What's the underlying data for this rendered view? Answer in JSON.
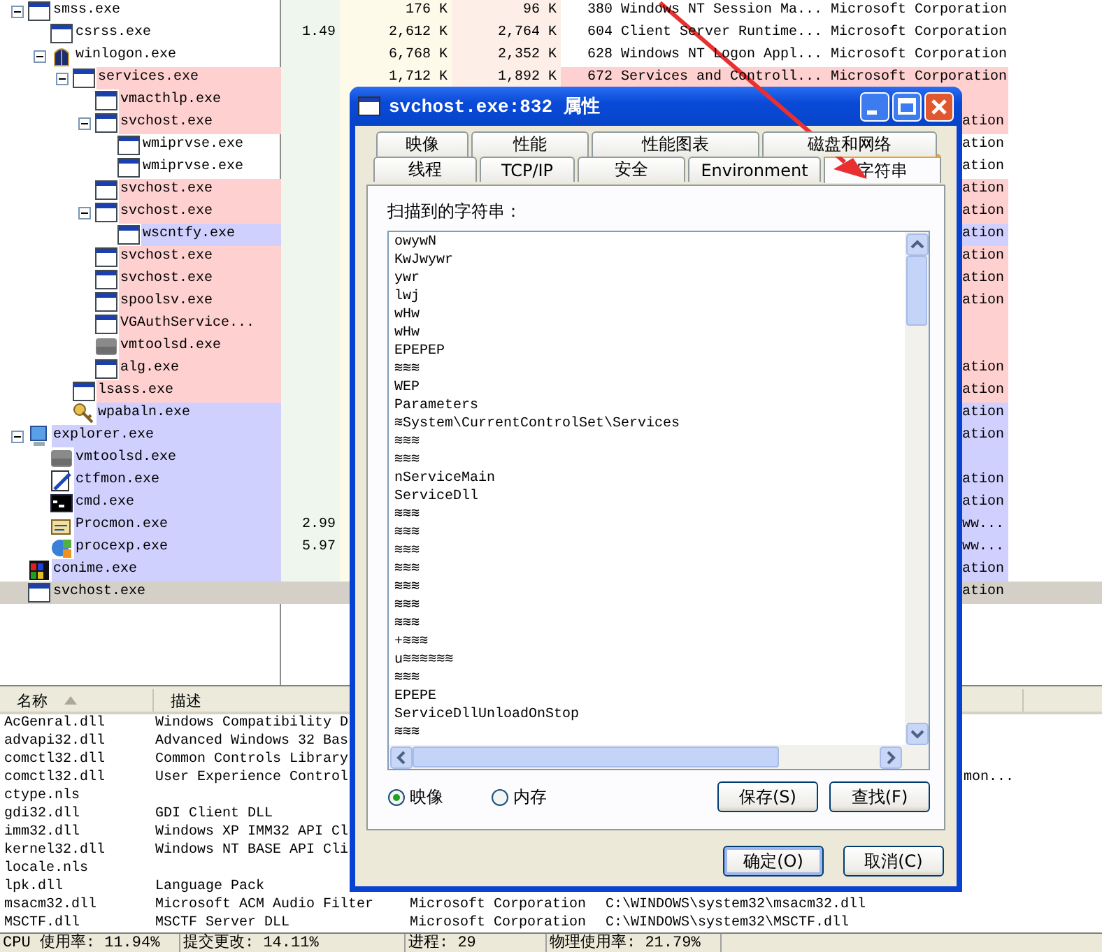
{
  "process_tree": {
    "rows": [
      {
        "name": "smss.exe",
        "kind": "window",
        "expanded": true,
        "selected": false,
        "private_bytes": "176 K",
        "working_set": "96 K",
        "pid": "380",
        "description": "Windows NT Session Ma...",
        "company": "Microsoft Corporation",
        "children": [
          {
            "name": "csrss.exe",
            "kind": "window",
            "selected": false,
            "cpu": "1.49",
            "private_bytes": "2,612 K",
            "working_set": "2,764 K",
            "pid": "604",
            "description": "Client Server Runtime...",
            "company": "Microsoft Corporation"
          },
          {
            "name": "winlogon.exe",
            "kind": "winlogon",
            "expanded": true,
            "selected": false,
            "private_bytes": "6,768 K",
            "working_set": "2,352 K",
            "pid": "628",
            "description": "Windows NT Logon Appl...",
            "company": "Microsoft Corporation",
            "children": [
              {
                "name": "services.exe",
                "kind": "window",
                "color": "#ffd0d0",
                "expanded": true,
                "selected": false,
                "private_bytes": "1,712 K",
                "working_set": "1,892 K",
                "pid": "672",
                "description": "Services and Controll...",
                "company": "Microsoft Corporation",
                "children": [
                  {
                    "name": "vmacthlp.exe",
                    "kind": "window",
                    "color": "#ffd0d0",
                    "selected": false
                  },
                  {
                    "name": "svchost.exe",
                    "kind": "window",
                    "color": "#ffd0d0",
                    "expanded": true,
                    "selected": false,
                    "company": "ation",
                    "children": [
                      {
                        "name": "wmiprvse.exe",
                        "kind": "window",
                        "selected": false,
                        "company": "ation"
                      },
                      {
                        "name": "wmiprvse.exe",
                        "kind": "window",
                        "selected": false,
                        "company": "ation"
                      }
                    ]
                  },
                  {
                    "name": "svchost.exe",
                    "kind": "window",
                    "color": "#ffd0d0",
                    "selected": false,
                    "company": "ation"
                  },
                  {
                    "name": "svchost.exe",
                    "kind": "window",
                    "color": "#ffd0d0",
                    "expanded": true,
                    "selected": false,
                    "company": "ation",
                    "children": [
                      {
                        "name": "wscntfy.exe",
                        "kind": "window",
                        "color": "#d0d0ff",
                        "selected": false,
                        "company": "ation"
                      }
                    ]
                  },
                  {
                    "name": "svchost.exe",
                    "kind": "window",
                    "color": "#ffd0d0",
                    "selected": false,
                    "company": "ation"
                  },
                  {
                    "name": "svchost.exe",
                    "kind": "window",
                    "color": "#ffd0d0",
                    "selected": false,
                    "company": "ation"
                  },
                  {
                    "name": "spoolsv.exe",
                    "kind": "window",
                    "color": "#ffd0d0",
                    "selected": false,
                    "company": "ation"
                  },
                  {
                    "name": "VGAuthService...",
                    "kind": "window",
                    "color": "#ffd0d0",
                    "selected": false
                  },
                  {
                    "name": "vmtoolsd.exe",
                    "kind": "vm",
                    "color": "#ffd0d0",
                    "selected": false
                  },
                  {
                    "name": "alg.exe",
                    "kind": "window",
                    "color": "#ffd0d0",
                    "selected": false,
                    "company": "ation"
                  }
                ]
              },
              {
                "name": "lsass.exe",
                "kind": "window",
                "color": "#ffd0d0",
                "selected": false,
                "company": "ation"
              },
              {
                "name": "wpabaln.exe",
                "kind": "key",
                "color": "#d0d0ff",
                "selected": false,
                "company": "ation"
              }
            ]
          }
        ]
      },
      {
        "name": "explorer.exe",
        "kind": "computer",
        "color": "#d0d0ff",
        "expanded": true,
        "selected": false,
        "company": "ation",
        "children": [
          {
            "name": "vmtoolsd.exe",
            "kind": "vm",
            "color": "#d0d0ff",
            "selected": false
          },
          {
            "name": "ctfmon.exe",
            "kind": "pen",
            "color": "#d0d0ff",
            "selected": false,
            "company": "ation"
          },
          {
            "name": "cmd.exe",
            "kind": "console",
            "color": "#d0d0ff",
            "selected": false,
            "company": "ation"
          },
          {
            "name": "Procmon.exe",
            "kind": "monitor",
            "color": "#d0d0ff",
            "selected": false,
            "cpu": "2.99",
            "company": "ww..."
          },
          {
            "name": "procexp.exe",
            "kind": "explorer",
            "color": "#d0d0ff",
            "selected": false,
            "cpu": "5.97",
            "company": "ww..."
          }
        ]
      },
      {
        "name": "conime.exe",
        "kind": "ime",
        "color": "#d0d0ff",
        "selected": false,
        "company": "ation"
      },
      {
        "name": "svchost.exe",
        "kind": "window",
        "selected": true,
        "company": "ation"
      }
    ]
  },
  "module_list": {
    "columns": [
      "名称",
      "描述"
    ],
    "rows": [
      {
        "name": "AcGenral.dll",
        "description": "Windows Compatibility D"
      },
      {
        "name": "advapi32.dll",
        "description": "Advanced Windows 32 Bas"
      },
      {
        "name": "comctl32.dll",
        "description": "Common Controls Library"
      },
      {
        "name": "comctl32.dll",
        "description": "User Experience Control",
        "path": "mon..."
      },
      {
        "name": "ctype.nls"
      },
      {
        "name": "gdi32.dll",
        "description": "GDI Client DLL"
      },
      {
        "name": "imm32.dll",
        "description": "Windows XP IMM32 API Cl"
      },
      {
        "name": "kernel32.dll",
        "description": "Windows NT BASE API Cli"
      },
      {
        "name": "locale.nls"
      },
      {
        "name": "lpk.dll",
        "description": "Language Pack"
      },
      {
        "name": "msacm32.dll",
        "description": "Microsoft ACM Audio Filter",
        "company": "Microsoft Corporation",
        "path": "C:\\WINDOWS\\system32\\msacm32.dll"
      },
      {
        "name": "MSCTF.dll",
        "description": "MSCTF Server DLL",
        "company": "Microsoft Corporation",
        "path": "C:\\WINDOWS\\system32\\MSCTF.dll"
      }
    ]
  },
  "status_bar": [
    "CPU 使用率: 11.94%",
    "提交更改: 14.11%",
    "进程: 29",
    "物理使用率: 21.79%"
  ],
  "dialog": {
    "title": "svchost.exe:832 属性",
    "tab_rows": [
      {
        "tabs": [
          {
            "label": "映像",
            "selected": false
          },
          {
            "label": "性能",
            "selected": false
          },
          {
            "label": "性能图表",
            "selected": false
          },
          {
            "label": "磁盘和网络",
            "selected": false
          }
        ]
      },
      {
        "tabs": [
          {
            "label": "线程",
            "selected": false
          },
          {
            "label": "TCP/IP",
            "selected": false
          },
          {
            "label": "安全",
            "selected": false
          },
          {
            "label": "Environment",
            "selected": false
          },
          {
            "label": "字符串",
            "selected": true
          }
        ]
      }
    ],
    "label": "扫描到的字符串：",
    "strings": [
      "owywN",
      "KwJwywr",
      "ywr",
      "lwj",
      "wHw",
      "wHw",
      "EPEPEP",
      "≋≋≋",
      "WEP",
      "Parameters",
      "≋System\\CurrentControlSet\\Services",
      "≋≋≋",
      "≋≋≋",
      "nServiceMain",
      "ServiceDll",
      "≋≋≋",
      "≋≋≋",
      "≋≋≋",
      "≋≋≋",
      "≋≋≋",
      "≋≋≋",
      "≋≋≋",
      "+≋≋≋",
      "u≋≋≋≋≋≋",
      "≋≋≋",
      "EPEPE",
      "ServiceDllUnloadOnStop",
      "≋≋≋"
    ],
    "radios": [
      {
        "label": "映像",
        "selected": true
      },
      {
        "label": "内存",
        "selected": false
      }
    ],
    "panel_buttons": [
      "保存(S)",
      "查找(F)"
    ],
    "buttons": [
      "确定(O)",
      "取消(C)"
    ]
  }
}
